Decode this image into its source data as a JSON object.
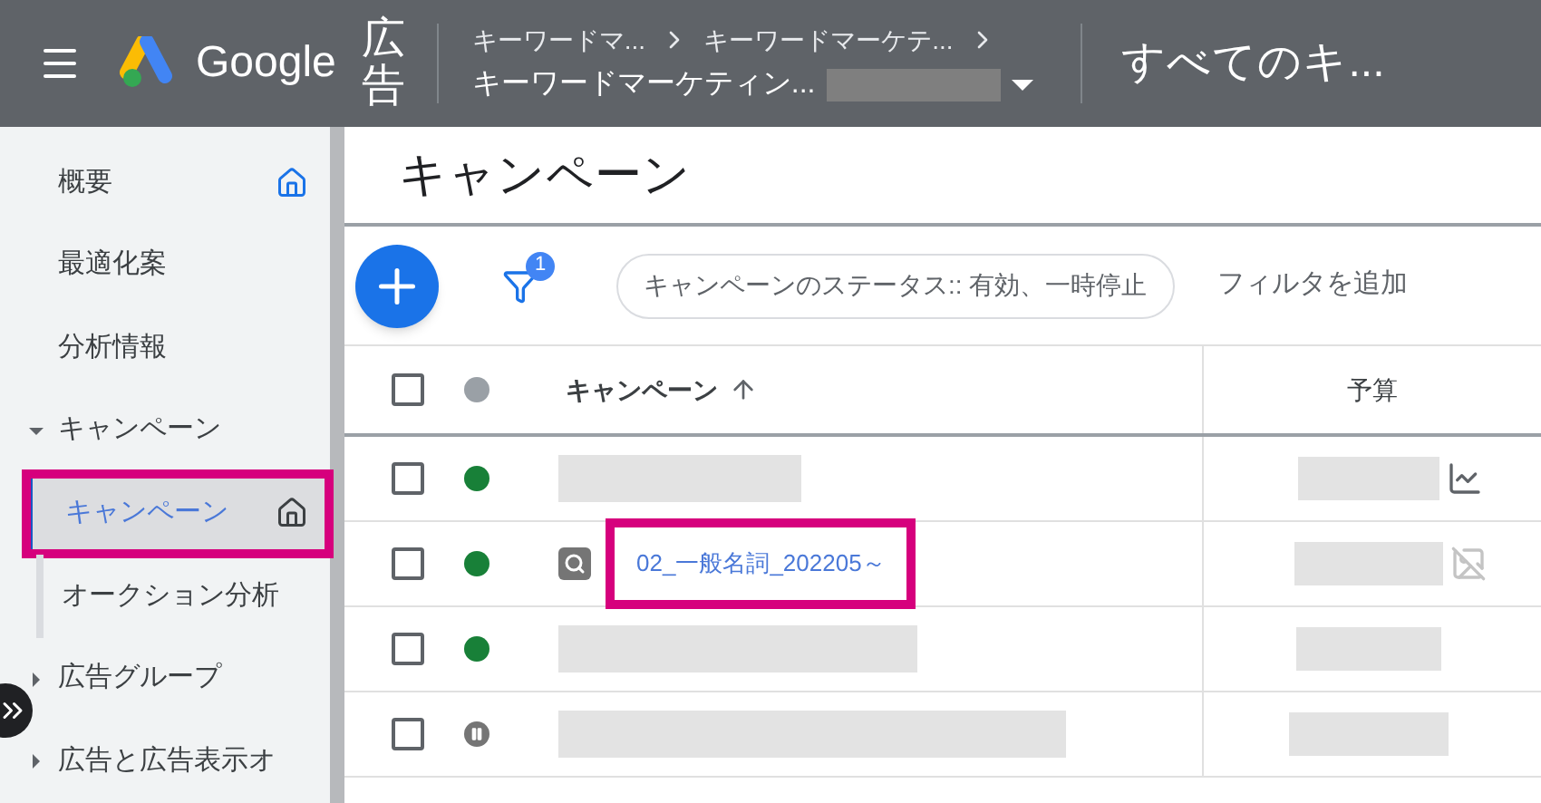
{
  "header": {
    "product": "Google",
    "product_suffix": "広告",
    "breadcrumb": [
      "キーワードマ...",
      "キーワードマーケテ..."
    ],
    "account": "キーワードマーケティン...",
    "view": "すべてのキ..."
  },
  "sidebar": {
    "items": [
      {
        "label": "概要",
        "kind": "item",
        "selected": false,
        "highlighted": false,
        "home_icon": true
      },
      {
        "label": "最適化案",
        "kind": "item",
        "selected": false,
        "highlighted": false,
        "home_icon": false
      },
      {
        "label": "分析情報",
        "kind": "item",
        "selected": false,
        "highlighted": false,
        "home_icon": false
      },
      {
        "label": "キャンペーン",
        "kind": "section",
        "expanded": true,
        "selected": false,
        "highlighted": false,
        "home_icon": false
      },
      {
        "label": "キャンペーン",
        "kind": "subitem",
        "selected": true,
        "highlighted": true,
        "home_icon": true
      },
      {
        "label": "オークション分析",
        "kind": "subitem",
        "selected": false,
        "highlighted": false,
        "home_icon": false
      },
      {
        "label": "広告グループ",
        "kind": "section",
        "expanded": false,
        "selected": false,
        "highlighted": false,
        "home_icon": false
      },
      {
        "label": "広告と広告表示オ",
        "kind": "section",
        "expanded": false,
        "selected": false,
        "highlighted": false,
        "home_icon": false
      }
    ]
  },
  "page_title": "キャンペーン",
  "toolbar": {
    "filter_count": "1",
    "filter_chip": "キャンペーンのステータス:: 有効、一時停止",
    "add_filter": "フィルタを追加"
  },
  "table": {
    "select_all_checked": false,
    "columns": [
      {
        "label": "キャンペーン",
        "sorted": true
      },
      {
        "label": "予算",
        "sorted": false
      }
    ],
    "rows": [
      {
        "checked": false,
        "paused": false,
        "search_icon": false,
        "chart_icon": true,
        "chart_on": true,
        "highlighted": false
      },
      {
        "checked": false,
        "paused": false,
        "search_icon": true,
        "name": "02_一般名詞_202205～",
        "chart_icon": true,
        "chart_on": false,
        "highlighted": true
      },
      {
        "checked": false,
        "paused": false,
        "search_icon": false,
        "chart_icon": false,
        "highlighted": false
      },
      {
        "checked": false,
        "paused": true,
        "search_icon": false,
        "chart_icon": false,
        "highlighted": false
      }
    ]
  }
}
